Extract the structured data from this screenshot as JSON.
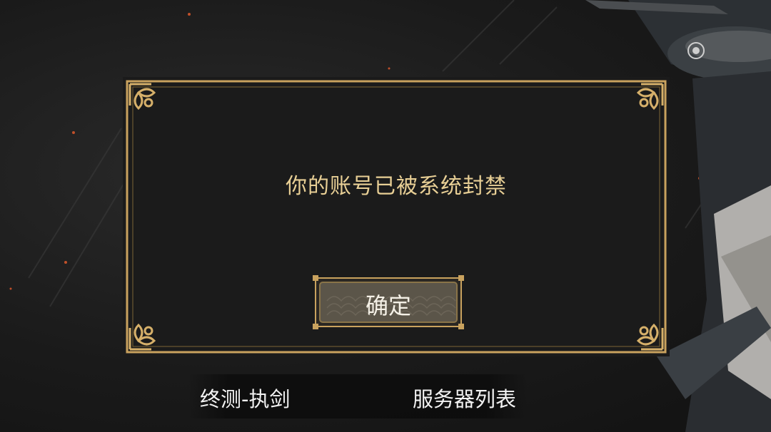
{
  "dialog": {
    "message": "你的账号已被系统封禁",
    "confirm_label": "确定"
  },
  "bottom_bar": {
    "server_name": "终测-执剑",
    "server_list_label": "服务器列表"
  },
  "colors": {
    "gold": "#c9a25e",
    "message_text": "#e8cf95",
    "background": "#1c1c1c"
  },
  "icons": [
    "corner-ornament-icon",
    "record-icon",
    "wave-pattern-icon"
  ]
}
